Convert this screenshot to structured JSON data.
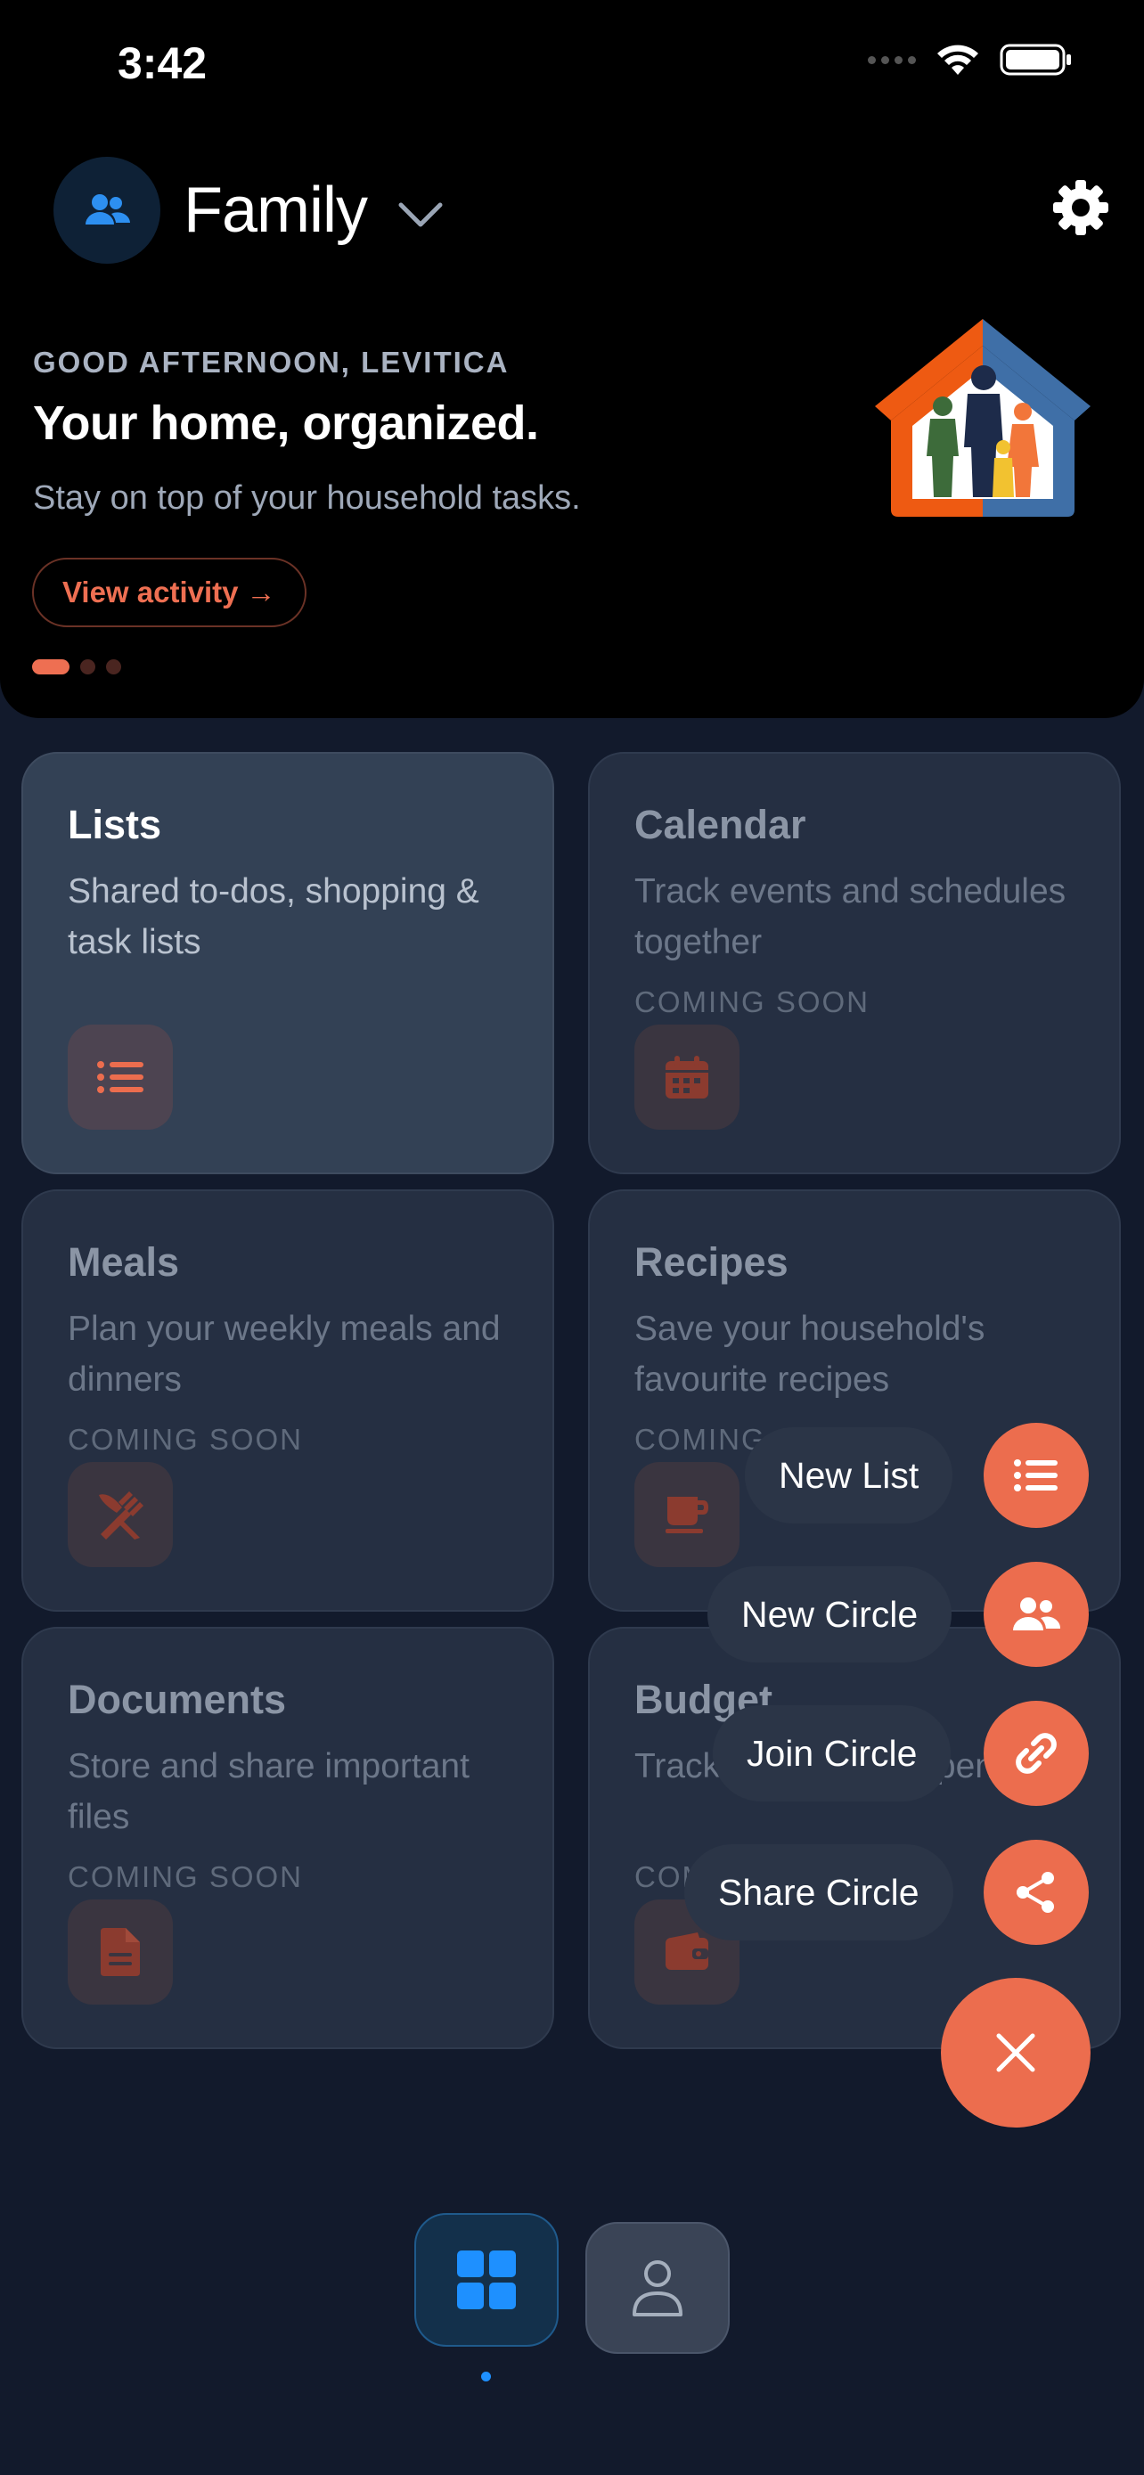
{
  "status_bar": {
    "time": "3:42"
  },
  "header": {
    "circle_name": "Family"
  },
  "hero": {
    "greeting": "GOOD AFTERNOON, LEVITICA",
    "headline": "Your home, organized.",
    "subline": "Stay on top of your household tasks.",
    "view_activity": "View activity →",
    "pager": {
      "current": 1,
      "total": 3
    }
  },
  "cards": [
    {
      "title": "Lists",
      "desc": "Shared to-dos, shopping & task lists",
      "soon": "",
      "icon": "list-icon"
    },
    {
      "title": "Calendar",
      "desc": "Track events and schedules together",
      "soon": "COMING SOON",
      "icon": "calendar-icon"
    },
    {
      "title": "Meals",
      "desc": "Plan your weekly meals and dinners",
      "soon": "COMING SOON",
      "icon": "utensils-icon"
    },
    {
      "title": "Recipes",
      "desc": "Save your household's favourite recipes",
      "soon": "COMING SOON",
      "icon": "cup-icon"
    },
    {
      "title": "Documents",
      "desc": "Store and share important files",
      "soon": "COMING SOON",
      "icon": "file-icon"
    },
    {
      "title": "Budget",
      "desc": "Track household expenses",
      "soon": "COMING SOON",
      "icon": "wallet-icon"
    }
  ],
  "fab_menu": [
    {
      "label": "New List",
      "icon": "list-icon"
    },
    {
      "label": "New Circle",
      "icon": "people-icon"
    },
    {
      "label": "Join Circle",
      "icon": "link-icon"
    },
    {
      "label": "Share Circle",
      "icon": "share-icon"
    }
  ],
  "tabs": [
    {
      "name": "home",
      "icon": "grid-icon",
      "active": true
    },
    {
      "name": "profile",
      "icon": "person-icon",
      "active": false
    }
  ],
  "colors": {
    "accent": "#ec6d4e",
    "blue": "#1e90ff",
    "background": "#121a2c"
  }
}
